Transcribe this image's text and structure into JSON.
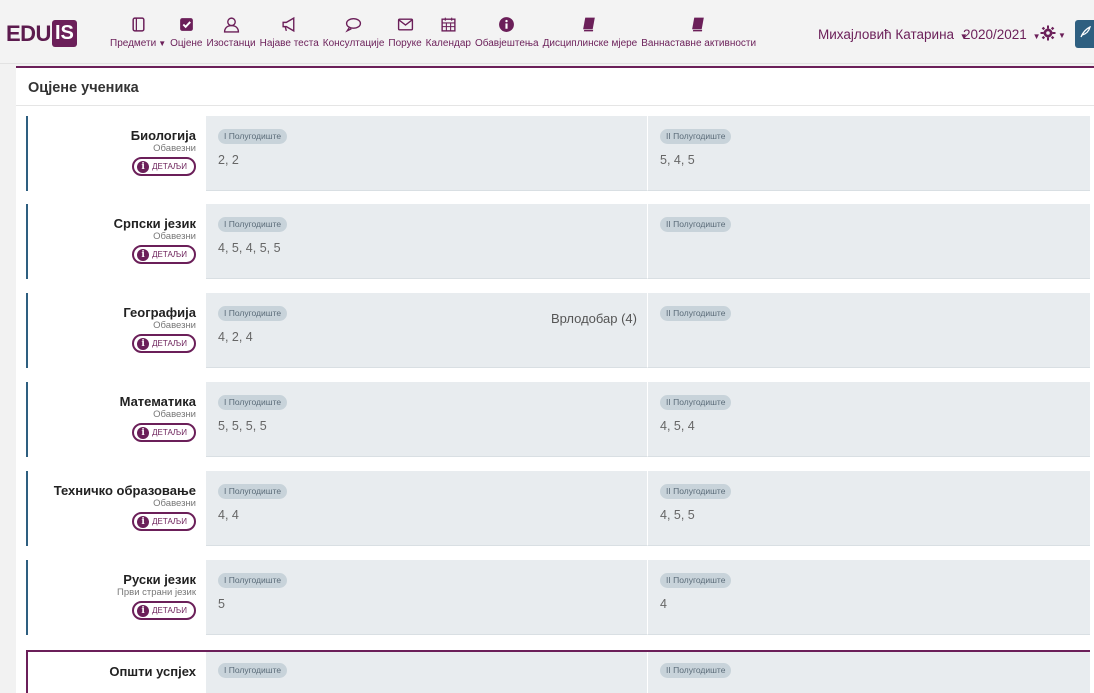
{
  "brand": {
    "logo_text": "EDU",
    "logo_box": "IS"
  },
  "nav": [
    {
      "label": "Предмети",
      "icon": "book-pages-icon",
      "dropdown": true
    },
    {
      "label": "Оцјене",
      "icon": "checkbox-icon",
      "dropdown": false
    },
    {
      "label": "Изостанци",
      "icon": "user-icon",
      "dropdown": false
    },
    {
      "label": "Најаве теста",
      "icon": "megaphone-icon",
      "dropdown": false
    },
    {
      "label": "Консултације",
      "icon": "chat-icon",
      "dropdown": false
    },
    {
      "label": "Поруке",
      "icon": "envelope-icon",
      "dropdown": false
    },
    {
      "label": "Календар",
      "icon": "calendar-icon",
      "dropdown": false
    },
    {
      "label": "Обавјештења",
      "icon": "info-icon",
      "dropdown": false
    },
    {
      "label": "Дисциплинске мјере",
      "icon": "book-icon",
      "dropdown": false
    },
    {
      "label": "Ваннаставне активности",
      "icon": "book-icon",
      "dropdown": false
    }
  ],
  "user": {
    "name": "Михајловић Катарина",
    "year": "2020/2021"
  },
  "page": {
    "title": "Оцјене ученика"
  },
  "colors": {
    "accent": "#6b1f59",
    "teal": "#2e5f80",
    "cell_bg": "#e8ecef"
  },
  "details_label": "ДЕТАЉИ",
  "semester_labels": {
    "first": "I Полугодиште",
    "second": "II Полугодиште"
  },
  "subjects": [
    {
      "name": "Биологија",
      "type": "Обавезни",
      "s1": "2, 2",
      "s1_final": "",
      "s2": "5, 4, 5"
    },
    {
      "name": "Српски језик",
      "type": "Обавезни",
      "s1": "4, 5, 4, 5, 5",
      "s1_final": "",
      "s2": ""
    },
    {
      "name": "Географија",
      "type": "Обавезни",
      "s1": "4, 2, 4",
      "s1_final": "Врлодобар (4)",
      "s2": ""
    },
    {
      "name": "Математика",
      "type": "Обавезни",
      "s1": "5, 5, 5, 5",
      "s1_final": "",
      "s2": "4, 5, 4"
    },
    {
      "name": "Техничко образовање",
      "type": "Обавезни",
      "s1": "4, 4",
      "s1_final": "",
      "s2": "4, 5, 5"
    },
    {
      "name": "Руски језик",
      "type": "Први страни језик",
      "s1": "5",
      "s1_final": "",
      "s2": "4"
    }
  ],
  "overall": {
    "name": "Општи успјех"
  }
}
